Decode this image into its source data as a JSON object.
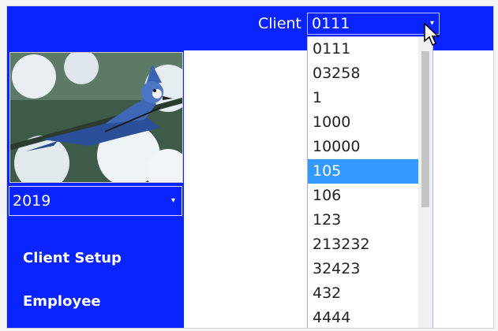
{
  "header": {
    "client_label": "Client",
    "client_selected": "0111",
    "dropdown_arrow": "▾"
  },
  "sidebar": {
    "year": "2019",
    "nav": [
      "Client Setup",
      "Employee"
    ]
  },
  "client_options": [
    "0111",
    "03258",
    "1",
    "1000",
    "10000",
    "105",
    "106",
    "123",
    "213232",
    "32423",
    "432",
    "4444"
  ],
  "highlighted_option": "105",
  "colors": {
    "accent": "#0a24ff",
    "highlight": "#3399ff"
  },
  "icons": [
    "dropdown-arrow-icon",
    "mouse-cursor-icon",
    "bird-photo"
  ]
}
